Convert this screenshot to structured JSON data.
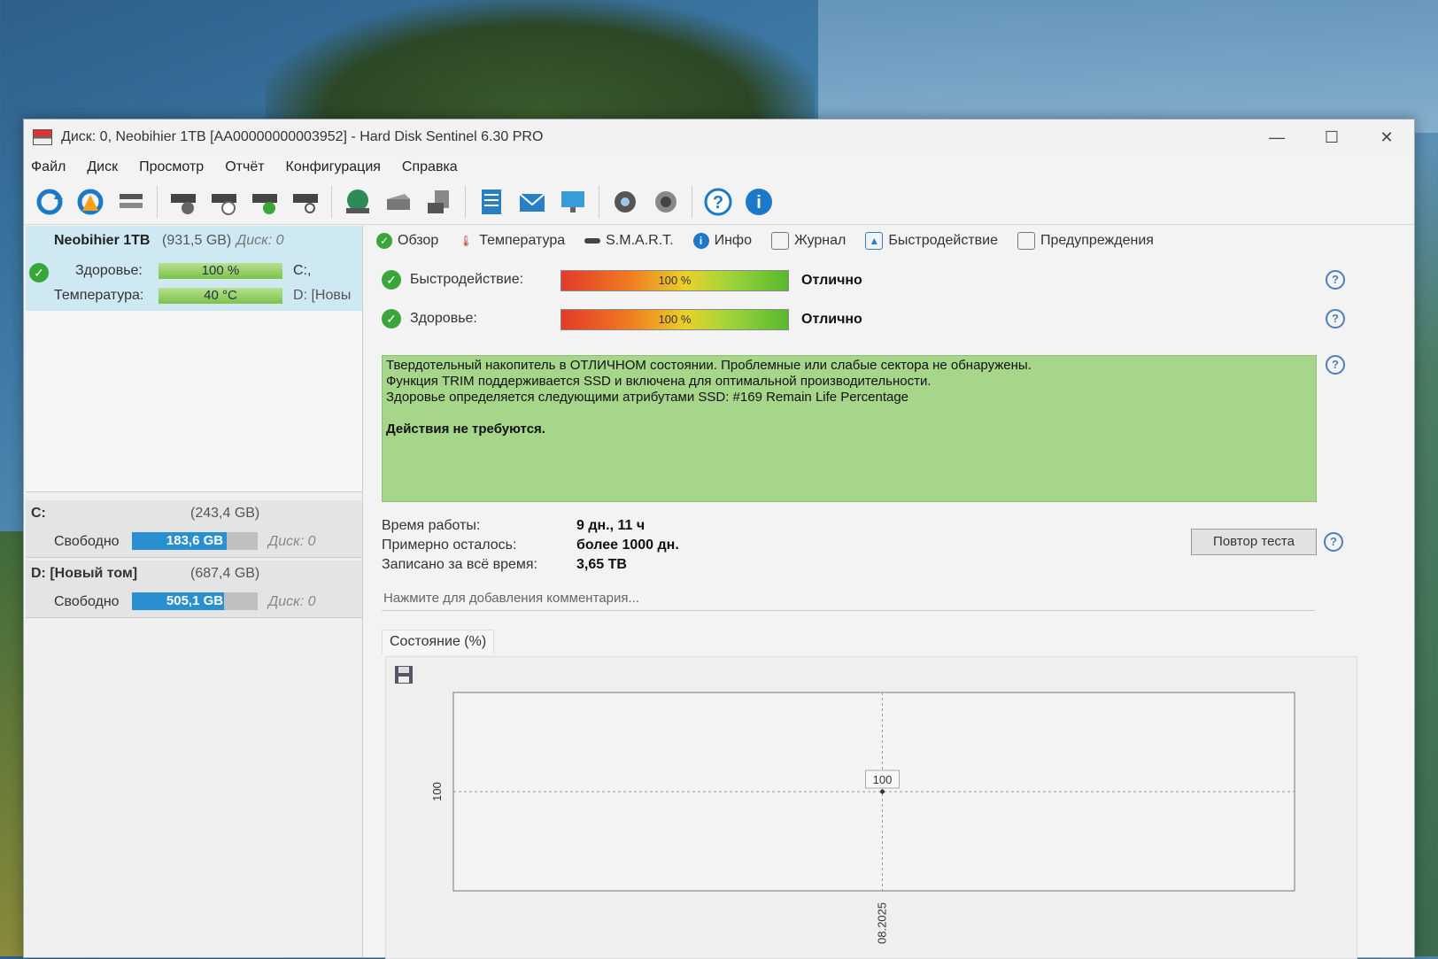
{
  "window": {
    "title": "Диск: 0, Neobihier 1TB [AA00000000003952]  -  Hard Disk Sentinel 6.30 PRO",
    "controls": {
      "minimize": "—",
      "maximize": "☐",
      "close": "✕"
    }
  },
  "menu": [
    "Файл",
    "Диск",
    "Просмотр",
    "Отчёт",
    "Конфигурация",
    "Справка"
  ],
  "toolbar": {
    "icons": [
      "refresh-icon",
      "refresh-warning-icon",
      "disk-list-icon",
      "disk-test-icon",
      "disk-timer-icon",
      "disk-ok-icon",
      "disk-search-icon",
      "globe-icon",
      "drive-icon",
      "network-drive-icon",
      "report-icon",
      "mail-icon",
      "computer-icon",
      "settings-icon",
      "speaker-icon",
      "help-icon",
      "info-icon"
    ]
  },
  "left": {
    "disk": {
      "name": "Neobihier 1TB",
      "size": "(931,5 GB)",
      "disk_no": "Диск: 0",
      "health_label": "Здоровье:",
      "health_value": "100 %",
      "health_pct": 100,
      "temp_label": "Температура:",
      "temp_value": "40 °C",
      "drive_c": "C:,",
      "drive_d": "D: [Новы"
    },
    "volumes": [
      {
        "letter": "C:",
        "size": "(243,4 GB)",
        "free_label": "Свободно",
        "free": "183,6 GB",
        "free_frac": 0.754,
        "disk": "Диск: 0"
      },
      {
        "letter": "D: [Новый том]",
        "size": "(687,4 GB)",
        "free_label": "Свободно",
        "free": "505,1 GB",
        "free_frac": 0.735,
        "disk": "Диск: 0"
      }
    ]
  },
  "tabs": [
    {
      "label": "Обзор",
      "icon": "check-icon"
    },
    {
      "label": "Температура",
      "icon": "thermometer-icon"
    },
    {
      "label": "S.M.A.R.T.",
      "icon": "smart-icon"
    },
    {
      "label": "Инфо",
      "icon": "info-icon"
    },
    {
      "label": "Журнал",
      "icon": "log-icon"
    },
    {
      "label": "Быстродействие",
      "icon": "performance-icon"
    },
    {
      "label": "Предупреждения",
      "icon": "alerts-icon"
    }
  ],
  "overview": {
    "perf_label": "Быстродействие:",
    "perf_value": "100 %",
    "perf_status": "Отлично",
    "health_label": "Здоровье:",
    "health_value": "100 %",
    "health_status": "Отлично",
    "status_lines": [
      "Твердотельный накопитель в ОТЛИЧНОМ состоянии. Проблемные или слабые сектора не обнаружены.",
      "Функция TRIM поддерживается SSD и включена для оптимальной производительности.",
      "Здоровье определяется следующими атрибутами SSD: #169 Remain Life Percentage"
    ],
    "action": "Действия не требуются.",
    "uptime_label": "Время работы:",
    "uptime_value": "9 дн., 11 ч",
    "remain_label": "Примерно осталось:",
    "remain_value": "более 1000 дн.",
    "written_label": "Записано за всё время:",
    "written_value": "3,65 TB",
    "retest_button": "Повтор теста",
    "comment_placeholder": "Нажмите для добавления комментария..."
  },
  "chart_data": {
    "type": "line",
    "title": "Состояние (%)",
    "series": [
      {
        "values": [
          100
        ]
      }
    ],
    "x": [
      "08.2025"
    ],
    "ytick": "100",
    "point_label": "100"
  }
}
